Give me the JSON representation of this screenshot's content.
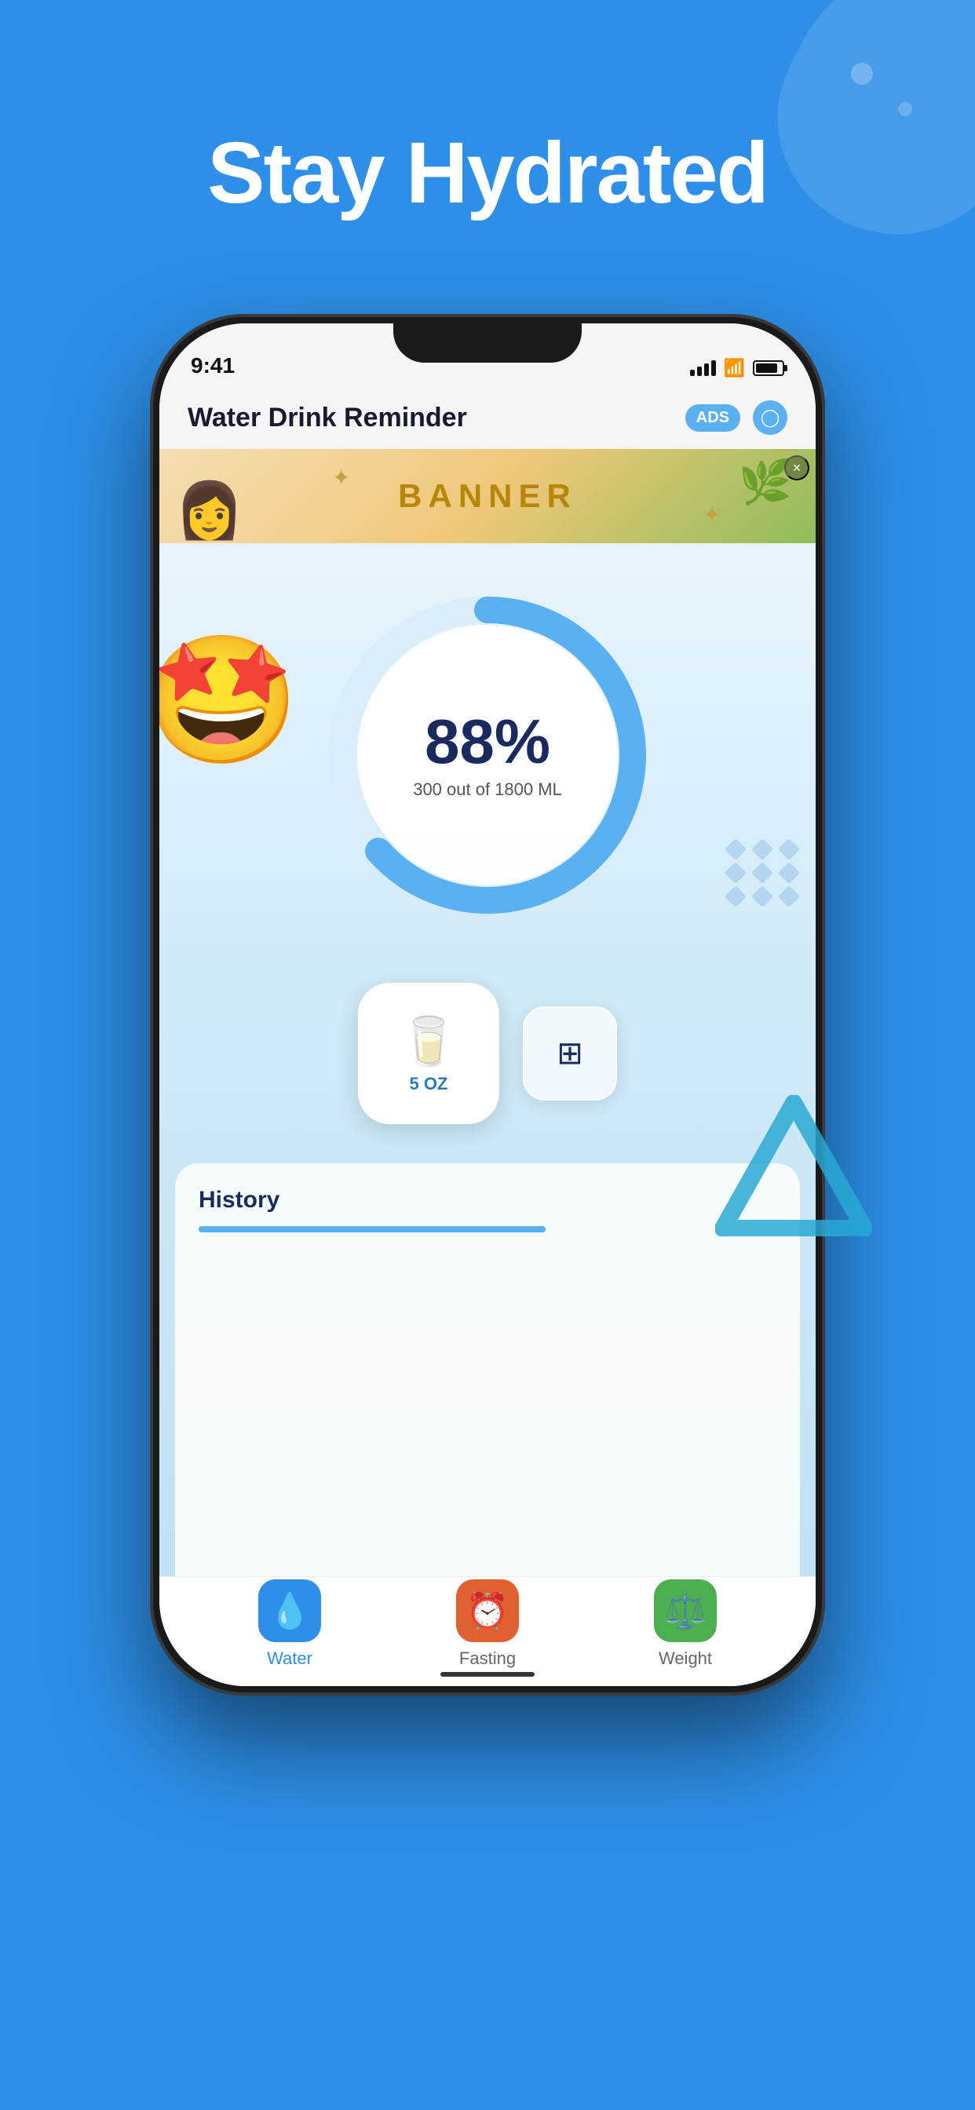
{
  "page": {
    "background_color": "#2d8fe8",
    "headline": "Stay Hydrated"
  },
  "status_bar": {
    "time": "9:41",
    "signal_label": "signal",
    "wifi_label": "wifi",
    "battery_label": "battery"
  },
  "app_header": {
    "title": "Water Drink Reminder",
    "ads_label": "ADS",
    "settings_label": "settings"
  },
  "banner": {
    "text": "BANNER",
    "close_label": "×"
  },
  "progress": {
    "percent": "88%",
    "detail": "300 out of 1800 ML",
    "value": 88,
    "emoji": "🤩"
  },
  "drink_buttons": {
    "primary_label": "5\nOZ",
    "secondary_label": "custom"
  },
  "history": {
    "title": "History"
  },
  "tab_bar": {
    "items": [
      {
        "id": "water",
        "label": "Water",
        "active": true
      },
      {
        "id": "fasting",
        "label": "Fasting",
        "active": false
      },
      {
        "id": "weight",
        "label": "Weight",
        "active": false
      }
    ]
  },
  "decorations": {
    "diamonds": [
      0,
      1,
      2,
      3,
      4,
      5,
      6,
      7,
      8
    ]
  }
}
